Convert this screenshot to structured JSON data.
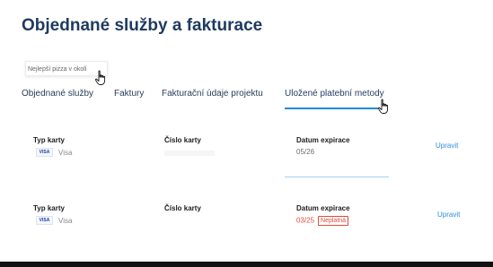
{
  "page": {
    "title": "Objednané služby a fakturace"
  },
  "project_select": {
    "value": "Nejlepší pizza v okolí"
  },
  "tabs": [
    {
      "label": "Objednané služby"
    },
    {
      "label": "Faktury"
    },
    {
      "label": "Fakturační údaje projektu"
    },
    {
      "label": "Uložené platební metody",
      "active": true
    }
  ],
  "payment_methods": {
    "columns": {
      "card_type": "Typ karty",
      "card_number": "Číslo karty",
      "expiry": "Datum expirace"
    },
    "rows": [
      {
        "brand_badge": "VISA",
        "card_type": "Visa",
        "expiry": "05/26",
        "expired": false,
        "edit_label": "Upravit"
      },
      {
        "brand_badge": "VISA",
        "card_type": "Visa",
        "expiry": "03/25",
        "expired": true,
        "invalid_label": "Neplatná",
        "edit_label": "Upravit"
      }
    ]
  },
  "colors": {
    "title": "#1f3a5f",
    "accent": "#1f8bd6",
    "link": "#2d8fdc",
    "error": "#e24b3d"
  },
  "icons": {
    "cursor": "hand-pointer-icon",
    "card_brand": "visa-card-icon"
  }
}
